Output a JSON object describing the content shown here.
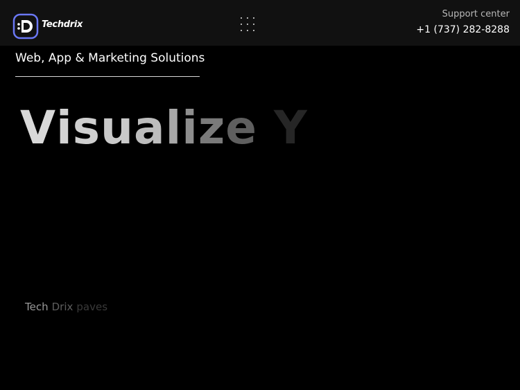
{
  "header": {
    "logo": {
      "text": "Techdrix",
      "icon": "techdrix-logo-icon"
    },
    "menu_icon": "grid-dots-menu-icon",
    "support": {
      "label": "Support center",
      "phone": "+1 (737) 282-8288"
    }
  },
  "hero": {
    "tagline": "Web, App & Marketing Solutions",
    "headline_chars": [
      "V",
      "i",
      "s",
      "u",
      "a",
      "l",
      "i",
      "z",
      "e",
      " ",
      "Y"
    ],
    "headline_colors": [
      "#d9d9d9",
      "#d3d3d3",
      "#cfcfcf",
      "#c9c9c9",
      "#bdbdbd",
      "#a8a8a8",
      "#8e8e8e",
      "#7a7a7a",
      "#5f5f5f",
      "#000000",
      "#262626"
    ],
    "subtext_words": [
      "Tech",
      "Drix",
      "paves"
    ],
    "subtext_colors": [
      "#9a9a9a",
      "#5e5e5e",
      "#3a3a3a"
    ]
  },
  "colors": {
    "background": "#000000",
    "header_bg": "#111111",
    "accent": "#5a6cf0"
  }
}
